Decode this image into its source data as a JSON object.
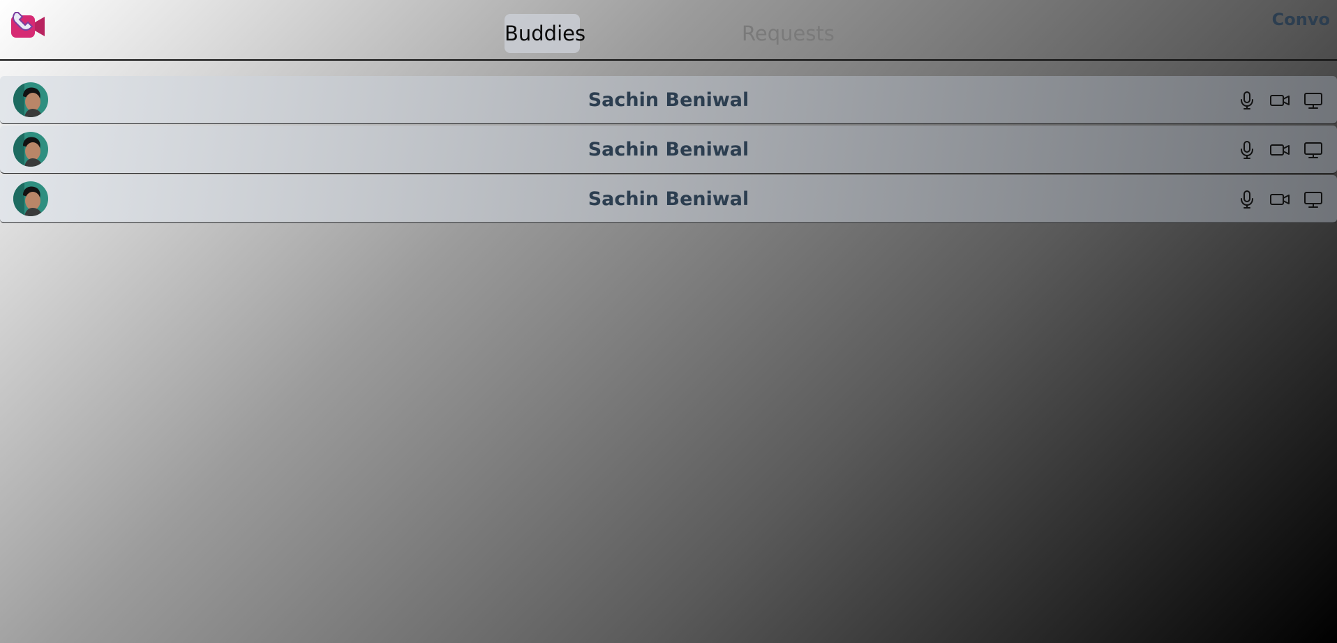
{
  "header": {
    "logo_icon": "video-call-logo-icon",
    "tabs": [
      {
        "label": "Buddies",
        "active": true
      },
      {
        "label": "Requests",
        "active": false
      }
    ],
    "brand": "Convo"
  },
  "buddies": [
    {
      "name": "Sachin Beniwal",
      "avatar_icon": "user-avatar",
      "actions": [
        "microphone-icon",
        "video-camera-icon",
        "monitor-icon"
      ]
    },
    {
      "name": "Sachin Beniwal",
      "avatar_icon": "user-avatar",
      "actions": [
        "microphone-icon",
        "video-camera-icon",
        "monitor-icon"
      ]
    },
    {
      "name": "Sachin Beniwal",
      "avatar_icon": "user-avatar",
      "actions": [
        "microphone-icon",
        "video-camera-icon",
        "monitor-icon"
      ]
    }
  ],
  "colors": {
    "brand_text": "#2c3e50",
    "logo_primary": "#d62a73",
    "logo_secondary": "#7b3fa0"
  }
}
